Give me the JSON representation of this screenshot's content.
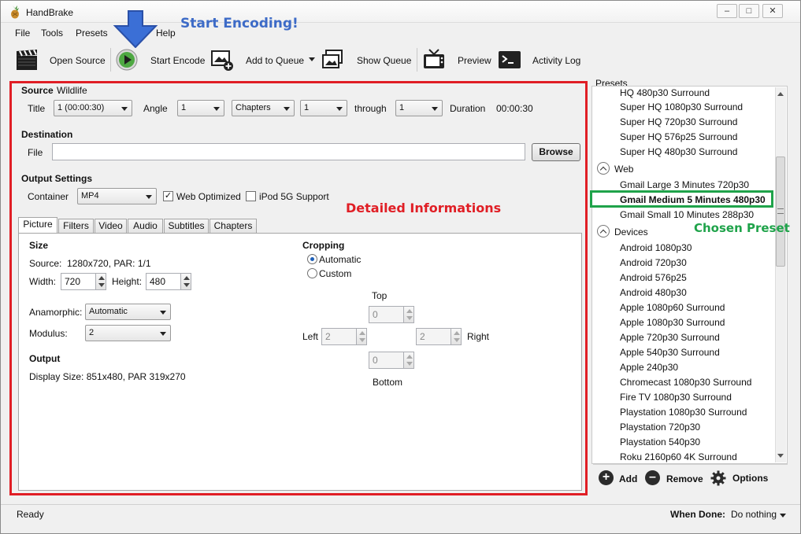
{
  "window": {
    "title": "HandBrake"
  },
  "menu": [
    "File",
    "Tools",
    "Presets",
    "Help"
  ],
  "toolbar": {
    "open_source": "Open Source",
    "start_encode": "Start Encode",
    "add_to_queue": "Add to Queue",
    "show_queue": "Show Queue",
    "preview": "Preview",
    "activity_log": "Activity Log"
  },
  "source": {
    "label": "Source",
    "value": "Wildlife"
  },
  "title_row": {
    "title_label": "Title",
    "title_value": "1 (00:00:30)",
    "angle_label": "Angle",
    "angle_value": "1",
    "range_mode": "Chapters",
    "range_start": "1",
    "through_label": "through",
    "range_end": "1",
    "duration_label": "Duration",
    "duration_value": "00:00:30"
  },
  "destination": {
    "heading": "Destination",
    "file_label": "File",
    "file_value": "",
    "browse": "Browse"
  },
  "output_settings": {
    "heading": "Output Settings",
    "container_label": "Container",
    "container_value": "MP4",
    "web_optimized": "Web Optimized",
    "web_optimized_checked": true,
    "ipod": "iPod 5G Support",
    "ipod_checked": false
  },
  "tabs": [
    "Picture",
    "Filters",
    "Video",
    "Audio",
    "Subtitles",
    "Chapters"
  ],
  "picture": {
    "size_heading": "Size",
    "source_label": "Source:",
    "source_value": "1280x720, PAR: 1/1",
    "width_label": "Width:",
    "width_value": "720",
    "height_label": "Height:",
    "height_value": "480",
    "anamorphic_label": "Anamorphic:",
    "anamorphic_value": "Automatic",
    "modulus_label": "Modulus:",
    "modulus_value": "2",
    "output_heading": "Output",
    "display_size": "Display Size: 851x480,  PAR 319x270",
    "cropping_heading": "Cropping",
    "crop_automatic": "Automatic",
    "crop_custom": "Custom",
    "top_label": "Top",
    "top_value": "0",
    "left_label": "Left",
    "left_value": "2",
    "right_label": "Right",
    "right_value": "2",
    "bottom_label": "Bottom",
    "bottom_value": "0"
  },
  "presets": {
    "heading": "Presets",
    "items_top": [
      "HQ 480p30 Surround",
      "Super HQ 1080p30 Surround",
      "Super HQ 720p30 Surround",
      "Super HQ 576p25 Surround",
      "Super HQ 480p30 Surround"
    ],
    "web_category": "Web",
    "web_items": [
      "Gmail Large 3 Minutes 720p30",
      "Gmail Medium 5 Minutes 480p30",
      "Gmail Small 10 Minutes 288p30"
    ],
    "devices_category": "Devices",
    "device_items": [
      "Android 1080p30",
      "Android 720p30",
      "Android 576p25",
      "Android 480p30",
      "Apple 1080p60 Surround",
      "Apple 1080p30 Surround",
      "Apple 720p30 Surround",
      "Apple 540p30 Surround",
      "Apple 240p30",
      "Chromecast 1080p30 Surround",
      "Fire TV 1080p30 Surround",
      "Playstation 1080p30 Surround",
      "Playstation 720p30",
      "Playstation 540p30",
      "Roku 2160p60 4K Surround"
    ],
    "add": "Add",
    "remove": "Remove",
    "options": "Options"
  },
  "status": {
    "text": "Ready",
    "when_done_label": "When Done:",
    "when_done_value": "Do nothing"
  },
  "annotations": {
    "start_encoding": "Start Encoding!",
    "detailed_informations": "Detailed Informations",
    "chosen_preset": "Chosen Preset"
  },
  "colors": {
    "annotation_blue": "#3d6bc7",
    "annotation_red": "#e01e25",
    "annotation_green": "#1fa34a"
  }
}
